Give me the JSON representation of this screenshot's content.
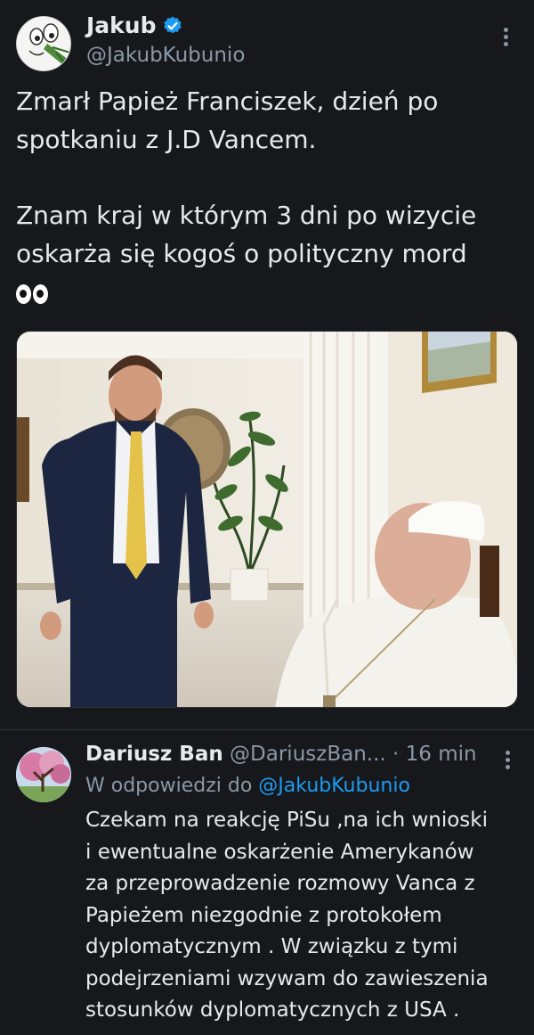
{
  "tweet": {
    "author_name": "Jakub",
    "author_handle": "@JakubKubunio",
    "verified": true,
    "text_lines_1": [
      "Zmarł Papież Franciszek, dzień po",
      "spotkaniu z J.D Vancem."
    ],
    "text_lines_2": [
      "Znam kraj w którym 3 dni po wizycie",
      "oskarża się kogoś o polityczny mord"
    ],
    "emoji": "eyes-emoji",
    "image_description_icon": "photo-of-meeting"
  },
  "reply": {
    "author_name": "Dariusz Ban",
    "author_handle": "@DariuszBan...",
    "separator": "·",
    "time": "16 min",
    "context_prefix": "W odpowiedzi do",
    "context_mention": "@JakubKubunio",
    "text_lines": [
      "Czekam na reakcję PiSu ,na ich wnioski",
      "i ewentualne oskarżenie Amerykanów",
      "za przeprowadzenie rozmowy Vanca z",
      "Papieżem niezgodnie z protokołem",
      "dyplomatycznym . W związku z tymi",
      "podejrzeniami wzywam do zawieszenia",
      "stosunków dyplomatycznych z USA ."
    ]
  },
  "colors": {
    "background": "#16181c",
    "text_primary": "#e7e9ea",
    "text_secondary": "#8b98a5",
    "link": "#1d9bf0",
    "verified_badge": "#1d9bf0"
  }
}
